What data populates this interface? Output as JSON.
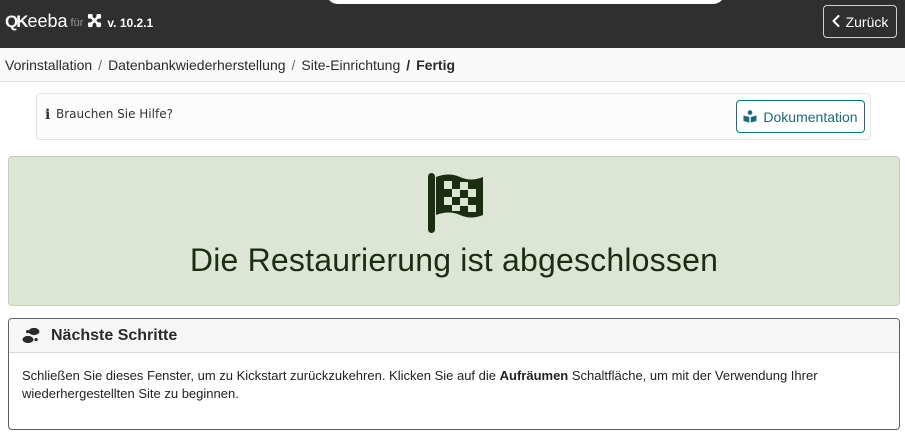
{
  "header": {
    "logo_mark": "QK",
    "logo_text": "eeba",
    "logo_fuer": "für",
    "version": "v. 10.2.1",
    "back_label": "Zurück",
    "bg_color": "#2f2f2f"
  },
  "breadcrumb": {
    "items": [
      "Vorinstallation",
      "Datenbankwiederherstellung",
      "Site-Einrichtung",
      "Fertig"
    ],
    "separator": "/"
  },
  "help": {
    "icon": "info-icon",
    "text": "Brauchen Sie Hilfe?",
    "doc_label": "Dokumentation",
    "doc_icon": "book-reader-icon",
    "accent": "#1e6a78"
  },
  "done": {
    "icon": "checkered-flag-icon",
    "title": "Die Restaurierung ist abgeschlossen",
    "bg_color": "#dde6d5"
  },
  "next_steps": {
    "icon": "footprints-icon",
    "title": "Nächste Schritte",
    "text_before": "Schließen Sie dieses Fenster, um zu Kickstart zurückzukehren. Klicken Sie auf die ",
    "text_bold": "Aufräumen",
    "text_after": " Schaltfläche, um mit der Verwendung Ihrer wiederhergestellten Site zu beginnen."
  }
}
